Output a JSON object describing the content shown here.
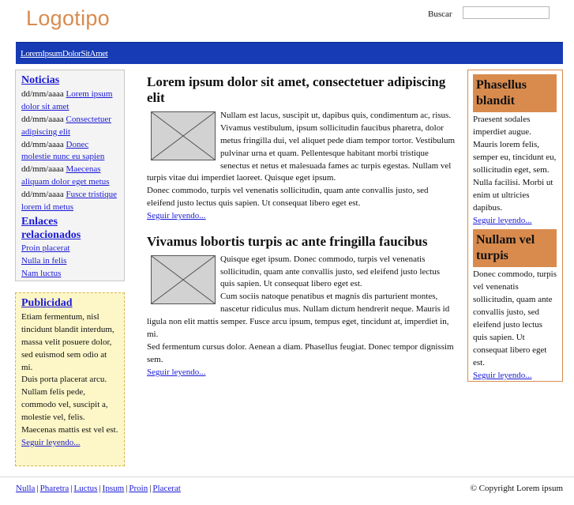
{
  "header": {
    "logo": "Logotipo",
    "search_label": "Buscar",
    "search_value": ""
  },
  "navbar": {
    "links": [
      "Lorem",
      "Ipsum",
      "Dolor",
      "Sit",
      "Amet"
    ]
  },
  "news": {
    "title": "Noticias",
    "items": [
      {
        "date": "dd/mm/aaaa",
        "link": "Lorem ipsum dolor sit amet"
      },
      {
        "date": "dd/mm/aaaa",
        "link": "Consectetuer adipiscing elit"
      },
      {
        "date": "dd/mm/aaaa",
        "link": "Donec molestie nunc eu sapien"
      },
      {
        "date": "dd/mm/aaaa",
        "link": "Maecenas aliquam dolor eget metus"
      },
      {
        "date": "dd/mm/aaaa",
        "link": "Fusce tristique lorem id metus"
      }
    ],
    "related_title": "Enlaces relacionados",
    "related_links": [
      "Proin placerat",
      "Nulla in felis",
      "Nam luctus"
    ]
  },
  "ad": {
    "title": "Publicidad",
    "text1": "Etiam fermentum, nisl tincidunt blandit interdum, massa velit posuere dolor, sed euismod sem odio at mi.",
    "text2": "Duis porta placerat arcu. Nullam felis pede, commodo vel, suscipit a, molestie vel, felis. Maecenas mattis est vel est.",
    "more": "Seguir leyendo..."
  },
  "articles": [
    {
      "title": "Lorem ipsum dolor sit amet, consectetuer adipiscing elit",
      "p1": "Nullam est lacus, suscipit ut, dapibus quis, condimentum ac, risus. Vivamus vestibulum, ipsum sollicitudin faucibus pharetra, dolor metus fringilla dui, vel aliquet pede diam tempor tortor. Vestibulum pulvinar urna et quam. Pellentesque habitant morbi tristique senectus et netus et malesuada fames ac turpis egestas. Nullam vel turpis vitae dui imperdiet laoreet. Quisque eget ipsum.",
      "p2": "Donec commodo, turpis vel venenatis sollicitudin, quam ante convallis justo, sed eleifend justo lectus quis sapien. Ut consequat libero eget est.",
      "more": "Seguir leyendo..."
    },
    {
      "title": "Vivamus lobortis turpis ac ante fringilla faucibus",
      "p1": "Quisque eget ipsum. Donec commodo, turpis vel venenatis sollicitudin, quam ante convallis justo, sed eleifend justo lectus quis sapien. Ut consequat libero eget est.",
      "p2": "Cum sociis natoque penatibus et magnis dis parturient montes, nascetur ridiculus mus. Nullam dictum hendrerit neque. Mauris id ligula non elit mattis semper. Fusce arcu ipsum, tempus eget, tincidunt at, imperdiet in, mi.",
      "p3": "Sed fermentum cursus dolor. Aenean a diam. Phasellus feugiat. Donec tempor dignissim sem.",
      "more": "Seguir leyendo..."
    }
  ],
  "right": {
    "box1": {
      "title": "Phasellus blandit",
      "text": "Praesent sodales imperdiet augue. Mauris lorem felis, semper eu, tincidunt eu, sollicitudin eget, sem. Nulla facilisi. Morbi ut enim ut ultricies dapibus.",
      "more": "Seguir leyendo..."
    },
    "box2": {
      "title": "Nullam vel turpis",
      "text": "Donec commodo, turpis vel venenatis sollicitudin, quam ante convallis justo, sed eleifend justo lectus quis sapien. Ut consequat libero eget est.",
      "more": "Seguir leyendo..."
    }
  },
  "footer": {
    "links": [
      "Nulla",
      "Pharetra",
      "Luctus",
      "Ipsum",
      "Proin",
      "Placerat"
    ],
    "separator": "|",
    "copyright": "© Copyright Lorem ipsum"
  },
  "colors": {
    "logo": "#d98b4e",
    "navbar": "#173bb5",
    "accent_orange": "#d98b4e",
    "ad_background": "#fdf7c8",
    "link": "#1a1ad6"
  }
}
